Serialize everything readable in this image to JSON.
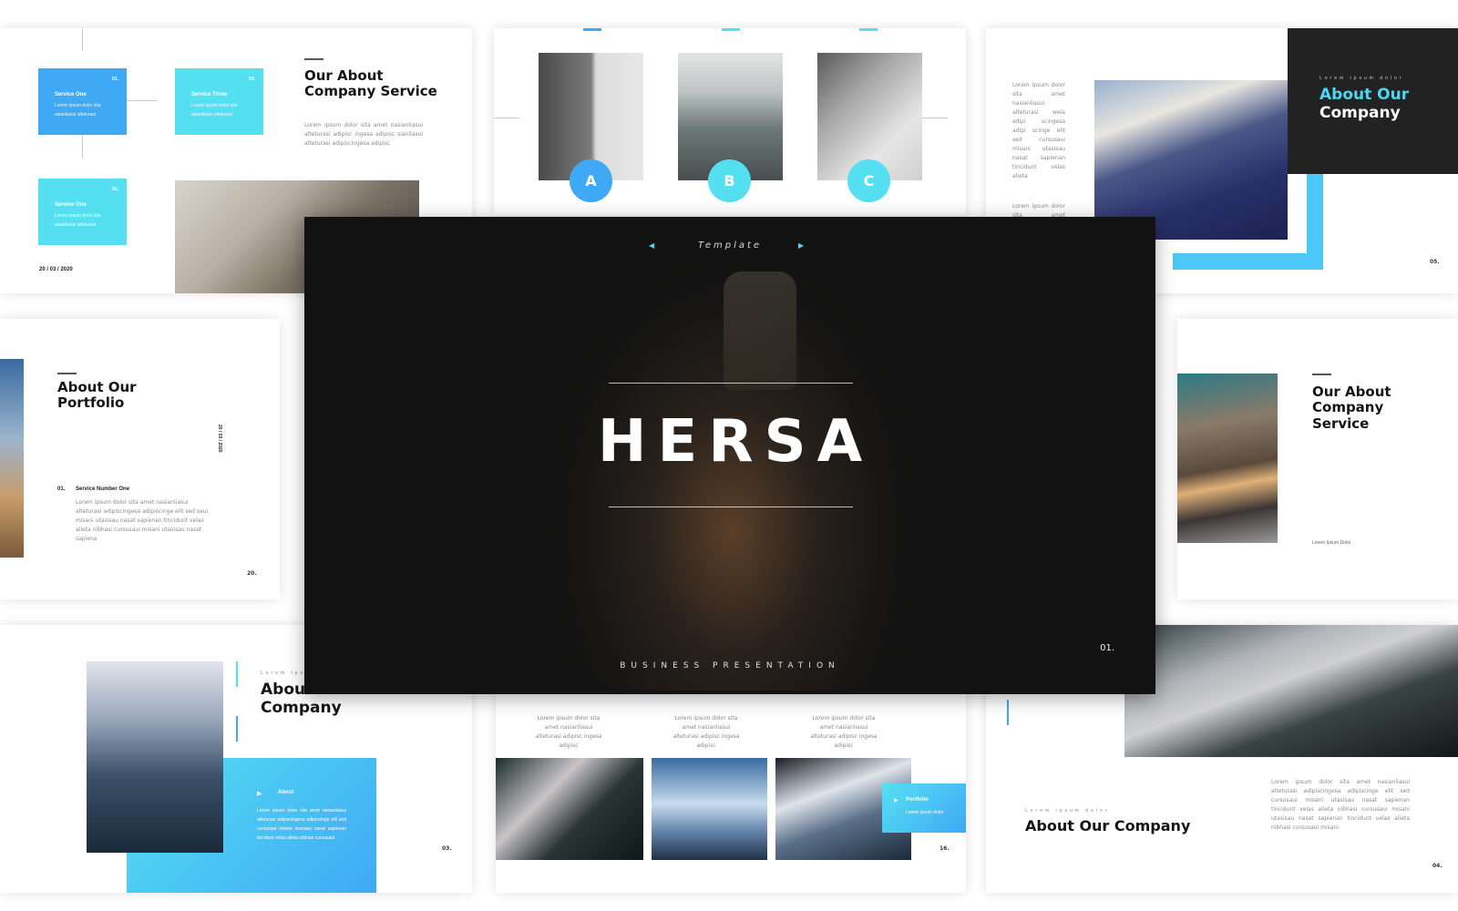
{
  "colors": {
    "accent_blue": "#3fa9f5",
    "accent_cyan": "#55e0f2",
    "dark": "#222222",
    "hero_bg": "#121212"
  },
  "hero": {
    "subtitle": "Template",
    "title": "HERSA",
    "footer": "BUSINESS PRESENTATION",
    "page": "01.",
    "icons": {
      "prev": "caret-left-icon",
      "next": "caret-right-icon"
    }
  },
  "slide_services": {
    "title_line1": "Our About",
    "title_line2": "Company Service",
    "body": "Lorem ipsum dolor sita amet nasianliasui alteturasi adipisc ingesa adipisc sianliasui alteturasi adipiscingesa adipisc",
    "date": "20 / 03 / 2020",
    "boxes": [
      {
        "num": "01.",
        "title": "Service One",
        "text": "Lorem ipsum dolor sita asianliasui alteturasi"
      },
      {
        "num": "03.",
        "title": "Service Three",
        "text": "Lorem ipsum dolor sita asianliasui alteturasi"
      },
      {
        "num": "02.",
        "title": "Service One",
        "text": "Lorem ipsum dolor sita asianliasui alteturasi"
      }
    ]
  },
  "slide_abc": {
    "labels": [
      "A",
      "B",
      "C"
    ]
  },
  "slide_about_dark": {
    "kicker": "Lorem ipsum dolor",
    "title_accent": "About Our",
    "title_rest": "Company",
    "body1": "Lorem ipsum dolor sita amet nasianliasui alteturasi weia adipi scingesa adipi scinge elit sed cursusaui misani utasisau nasat sapienan tincidunt velas alieta",
    "body2": "Lorem ipsum dolor sita amet nasianliasui",
    "page": "05."
  },
  "slide_portfolio": {
    "title_line1": "About Our",
    "title_line2": "Portfolio",
    "date": "20 / 03 / 2020",
    "item_num": "01.",
    "item_title": "Service Number One",
    "item_text": "Lorem ipsum dolor sita amet nasianliasui alteturasi adipiscingesa adipiscinge elit sed saui misani utasisau nasat sapienan tincidunt velas alieta nibhasi cursusaui misani utasisau nasat sapiena",
    "page": "20."
  },
  "slide_service_right": {
    "title_line1": "Our About",
    "title_line2": "Company",
    "title_line3": "Service",
    "caption": "Lorem Ipsum Dolor"
  },
  "slide_about_blue": {
    "kicker": "Lorem ipsum dolor",
    "title_line1": "About Our",
    "title_line2": "Company",
    "panel_title": "About",
    "panel_text": "Lorem ipsum dolor sita amet nasianliasui alteturasi adipiscingesa adipiscinge elit sed cursusaui misani utasisau nasat sapienan tincidunt velas alieta nibhasi cursusaui",
    "page": "03."
  },
  "slide_gallery": {
    "captions": [
      "Lorem ipsum dolor sita amet nasianliasui alteturasi adipisc ingesa adipisc",
      "Lorem ipsum dolor sita amet nasianliasui alteturasi adipisc ingesa adipisc",
      "Lorem ipsum dolor sita amet nasianliasui alteturasi adipisc ingesa adipisc"
    ],
    "tag_title": "Portfolio",
    "tag_text": "Lorem ipsum dolor",
    "page": "16."
  },
  "slide_about_wide": {
    "kicker": "Lorem ipsum dolor",
    "title": "About Our Company",
    "body": "Lorem ipsum dolor sita amet nasianliasui alteturasi adipiscingesa adipiscinge elit sed cursusaui misani utasisau nasat sapienan tincidunt velas alieta nibhasi cursusaui misani utasisau nasat sapienan tincidunt velas alieta nibhasi cursusaui misani",
    "page": "04."
  }
}
